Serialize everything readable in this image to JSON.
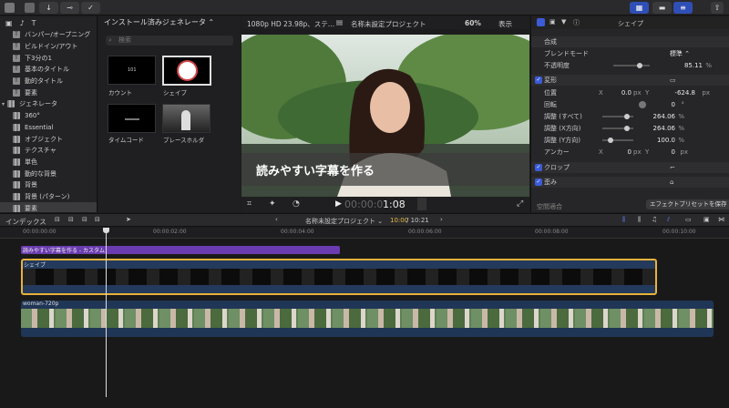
{
  "toolbar": {
    "buttons": [
      "download-icon",
      "key-icon",
      "check-icon"
    ],
    "accent": "#2f4fb6"
  },
  "library": {
    "items": [
      {
        "label": "バンパー/オープニング",
        "type": "child"
      },
      {
        "label": "ビルドイン/アウト",
        "type": "child"
      },
      {
        "label": "下3分の1",
        "type": "child"
      },
      {
        "label": "基本のタイトル",
        "type": "child"
      },
      {
        "label": "動的タイトル",
        "type": "child"
      },
      {
        "label": "要素",
        "type": "child"
      },
      {
        "label": "ジェネレータ",
        "type": "group"
      },
      {
        "label": "360°",
        "type": "child"
      },
      {
        "label": "Essential",
        "type": "child"
      },
      {
        "label": "オブジェクト",
        "type": "child"
      },
      {
        "label": "テクスチャ",
        "type": "child"
      },
      {
        "label": "単色",
        "type": "child"
      },
      {
        "label": "動的な背景",
        "type": "child"
      },
      {
        "label": "背景",
        "type": "child"
      },
      {
        "label": "背景 (パターン)",
        "type": "child"
      },
      {
        "label": "要素",
        "type": "child",
        "selected": true
      }
    ]
  },
  "browser": {
    "title": "インストール済みジェネレータ ⌃",
    "search_placeholder": "検索",
    "thumbnails": [
      {
        "label": "カウント",
        "inner": "101"
      },
      {
        "label": "シェイプ"
      },
      {
        "label": "タイムコード"
      },
      {
        "label": "プレースホルダ"
      }
    ]
  },
  "viewer": {
    "format": "1080p HD 23.98p、ステ…",
    "project": "名称未設定プロジェクト",
    "zoom": "60%",
    "view_menu": "表示",
    "subtitle": "読みやすい字幕を作る",
    "timecode_dim": "00:00:0",
    "timecode": "1:08"
  },
  "inspector": {
    "title": "シェイプ",
    "composite_title": "合成",
    "blend_mode_label": "ブレンドモード",
    "blend_mode_value": "標準 ⌃",
    "opacity_label": "不透明度",
    "opacity_value": "85.11",
    "percent": "%",
    "transform_title": "変形",
    "position_label": "位置",
    "pos_x_label": "X",
    "pos_x": "0.0",
    "px": "px",
    "pos_y_label": "Y",
    "pos_y": "-624.8",
    "rotation_label": "回転",
    "rotation": "0",
    "degree": "°",
    "scale_all_label": "調整 (すべて)",
    "scale_all": "264.06",
    "scale_x_label": "調整 (X方向)",
    "scale_x": "264.06",
    "scale_y_label": "調整 (Y方向)",
    "scale_y": "100.0",
    "anchor_label": "アンカー",
    "anchor_x_label": "X",
    "anchor_x": "0",
    "anchor_y_label": "Y",
    "anchor_y": "0",
    "crop_title": "クロップ",
    "distort_title": "歪み",
    "bottom_title": "空間適合",
    "save_preset": "エフェクトプリセットを保存"
  },
  "timeline_bar": {
    "index_label": "インデックス",
    "project": "名称未設定プロジェクト ⌄",
    "position": "10:00",
    "duration": "/ 10:21"
  },
  "ruler": [
    "00:00:00:00",
    "00:00:02:00",
    "00:00:04:00",
    "00:00:06:00",
    "00:00:08:00",
    "00:00:10:00"
  ],
  "clips": {
    "title_clip": "読みやすい字幕を作る - カスタム",
    "shape_clip": "シェイプ",
    "video_clip": "woman-720p"
  }
}
